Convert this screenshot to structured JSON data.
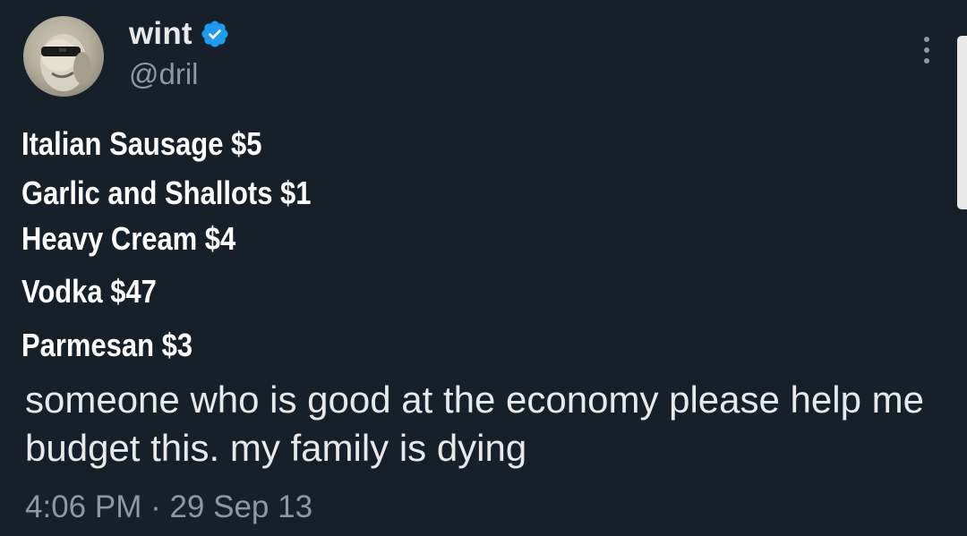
{
  "author": {
    "display_name": "wint",
    "handle": "@dril",
    "verified": true,
    "verified_color": "#1d9bf0"
  },
  "icons": {
    "avatar": "avatar",
    "verified": "verified-badge-icon",
    "more": "more-vertical-icon"
  },
  "image_lines": [
    "Italian Sausage $5",
    "Garlic and Shallots $1",
    "Heavy Cream $4",
    "Vodka $47",
    "Parmesan $3"
  ],
  "tweet": {
    "text": "someone who is good at the economy please help me budget this. my family is dying",
    "timestamp": "4:06 PM · 29 Sep 13"
  },
  "colors": {
    "background": "#15202b",
    "primary_text": "#e7e9ea",
    "secondary_text": "#8b98a5"
  }
}
